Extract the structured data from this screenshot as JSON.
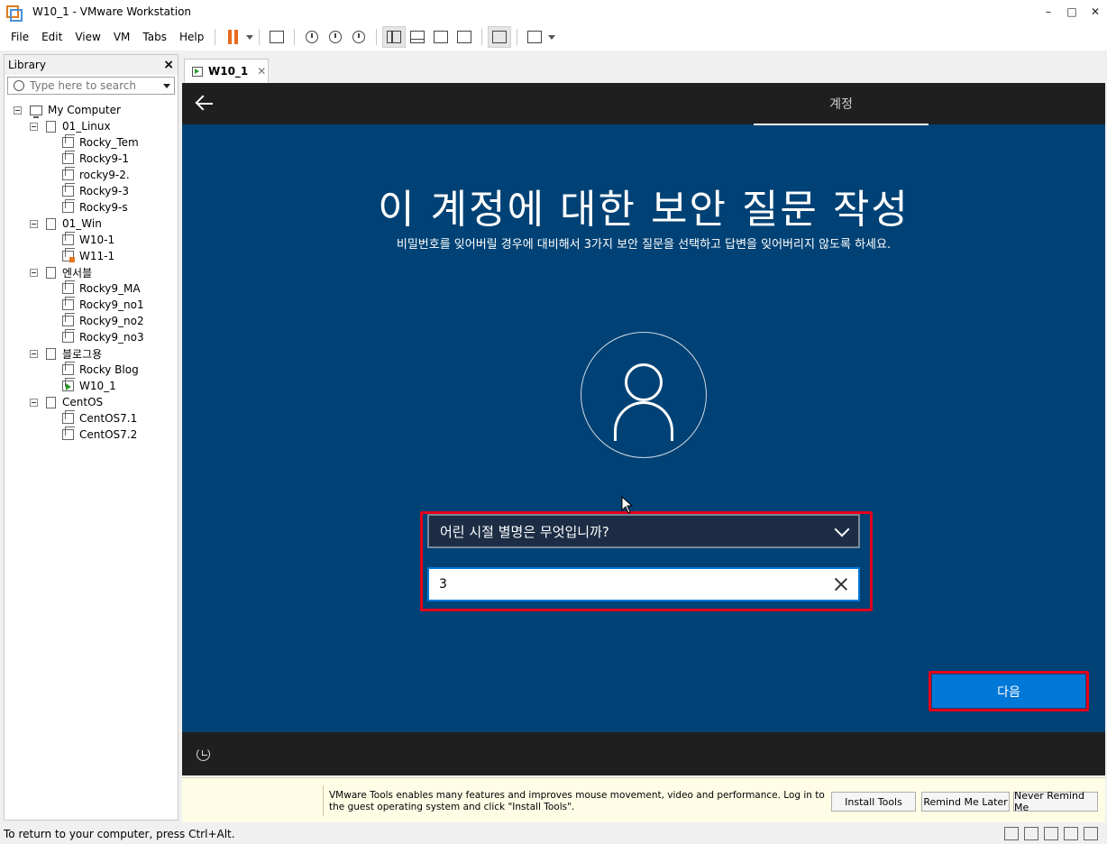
{
  "window": {
    "title": "W10_1 - VMware Workstation",
    "controls": [
      "–",
      "□",
      "✕"
    ]
  },
  "menu": [
    "File",
    "Edit",
    "View",
    "VM",
    "Tabs",
    "Help"
  ],
  "library": {
    "title": "Library",
    "close": "×",
    "search_placeholder": "Type here to search",
    "tree": {
      "root": "My Computer",
      "groups": [
        {
          "name": "01_Linux",
          "vms": [
            "Rocky_Tem",
            "Rocky9-1",
            "rocky9-2.",
            "Rocky9-3",
            "Rocky9-s"
          ]
        },
        {
          "name": "01_Win",
          "vms": [
            "W10-1",
            "W11-1"
          ]
        },
        {
          "name": "엔서블",
          "vms": [
            "Rocky9_MA",
            "Rocky9_no1",
            "Rocky9_no2",
            "Rocky9_no3"
          ]
        },
        {
          "name": "블로그용",
          "vms": [
            "Rocky Blog",
            "W10_1"
          ]
        },
        {
          "name": "CentOS",
          "vms": [
            "CentOS7.1",
            "CentOS7.2"
          ]
        }
      ]
    }
  },
  "tab": {
    "label": "W10_1",
    "close": "✕"
  },
  "guest": {
    "section_label": "계정",
    "title": "이 계정에 대한 보안 질문 작성",
    "subtitle": "비밀번호를 잊어버릴 경우에 대비해서 3가지 보안 질문을 선택하고 답변을 잊어버리지 않도록 하세요.",
    "question_selected": "어린 시절 별명은 무엇입니까?",
    "answer_value": "3",
    "next_label": "다음"
  },
  "tools_notification": {
    "message": "VMware Tools enables many features and improves mouse movement, video and performance. Log in to the guest operating system and click \"Install Tools\".",
    "install_label": "Install Tools",
    "remind_label": "Remind Me Later",
    "never_label": "Never Remind Me"
  },
  "status": {
    "text": "To return to your computer, press Ctrl+Alt."
  },
  "colors": {
    "oobe_blue": "#004275",
    "accent_blue": "#0078d7",
    "highlight_red": "#e3001b",
    "pause_orange": "#e86a1c"
  }
}
